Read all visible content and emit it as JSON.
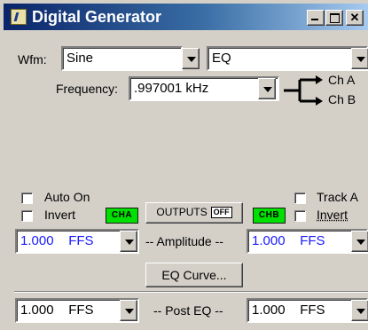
{
  "window": {
    "title": "Digital Generator",
    "caption_buttons": [
      "minimize",
      "maximize",
      "close"
    ]
  },
  "waveform": {
    "label": "Wfm:",
    "value": "Sine",
    "eq_value": "EQ"
  },
  "frequency": {
    "label": "Frequency:",
    "value": ".997001 kHz",
    "routes": [
      "Ch A",
      "Ch B"
    ]
  },
  "options": {
    "auto_on": "Auto On",
    "invert_a": "Invert",
    "track_a": "Track A",
    "invert_b": "Invert"
  },
  "badges": {
    "cha": "CHA",
    "chb": "CHB",
    "outputs_label": "OUTPUTS",
    "off": "OFF"
  },
  "amplitude": {
    "label": "-- Amplitude --",
    "a_value": "1.000",
    "a_unit": "FFS",
    "b_value": "1.000",
    "b_unit": "FFS"
  },
  "eq_curve_button": "EQ Curve...",
  "post_eq": {
    "label": "-- Post EQ --",
    "a_value": "1.000",
    "a_unit": "FFS",
    "b_value": "1.000",
    "b_unit": "FFS"
  },
  "colors": {
    "title_start": "#0a246a",
    "title_end": "#a6caf0",
    "badge_green": "#00e000",
    "value_blue": "#1a1aff"
  }
}
